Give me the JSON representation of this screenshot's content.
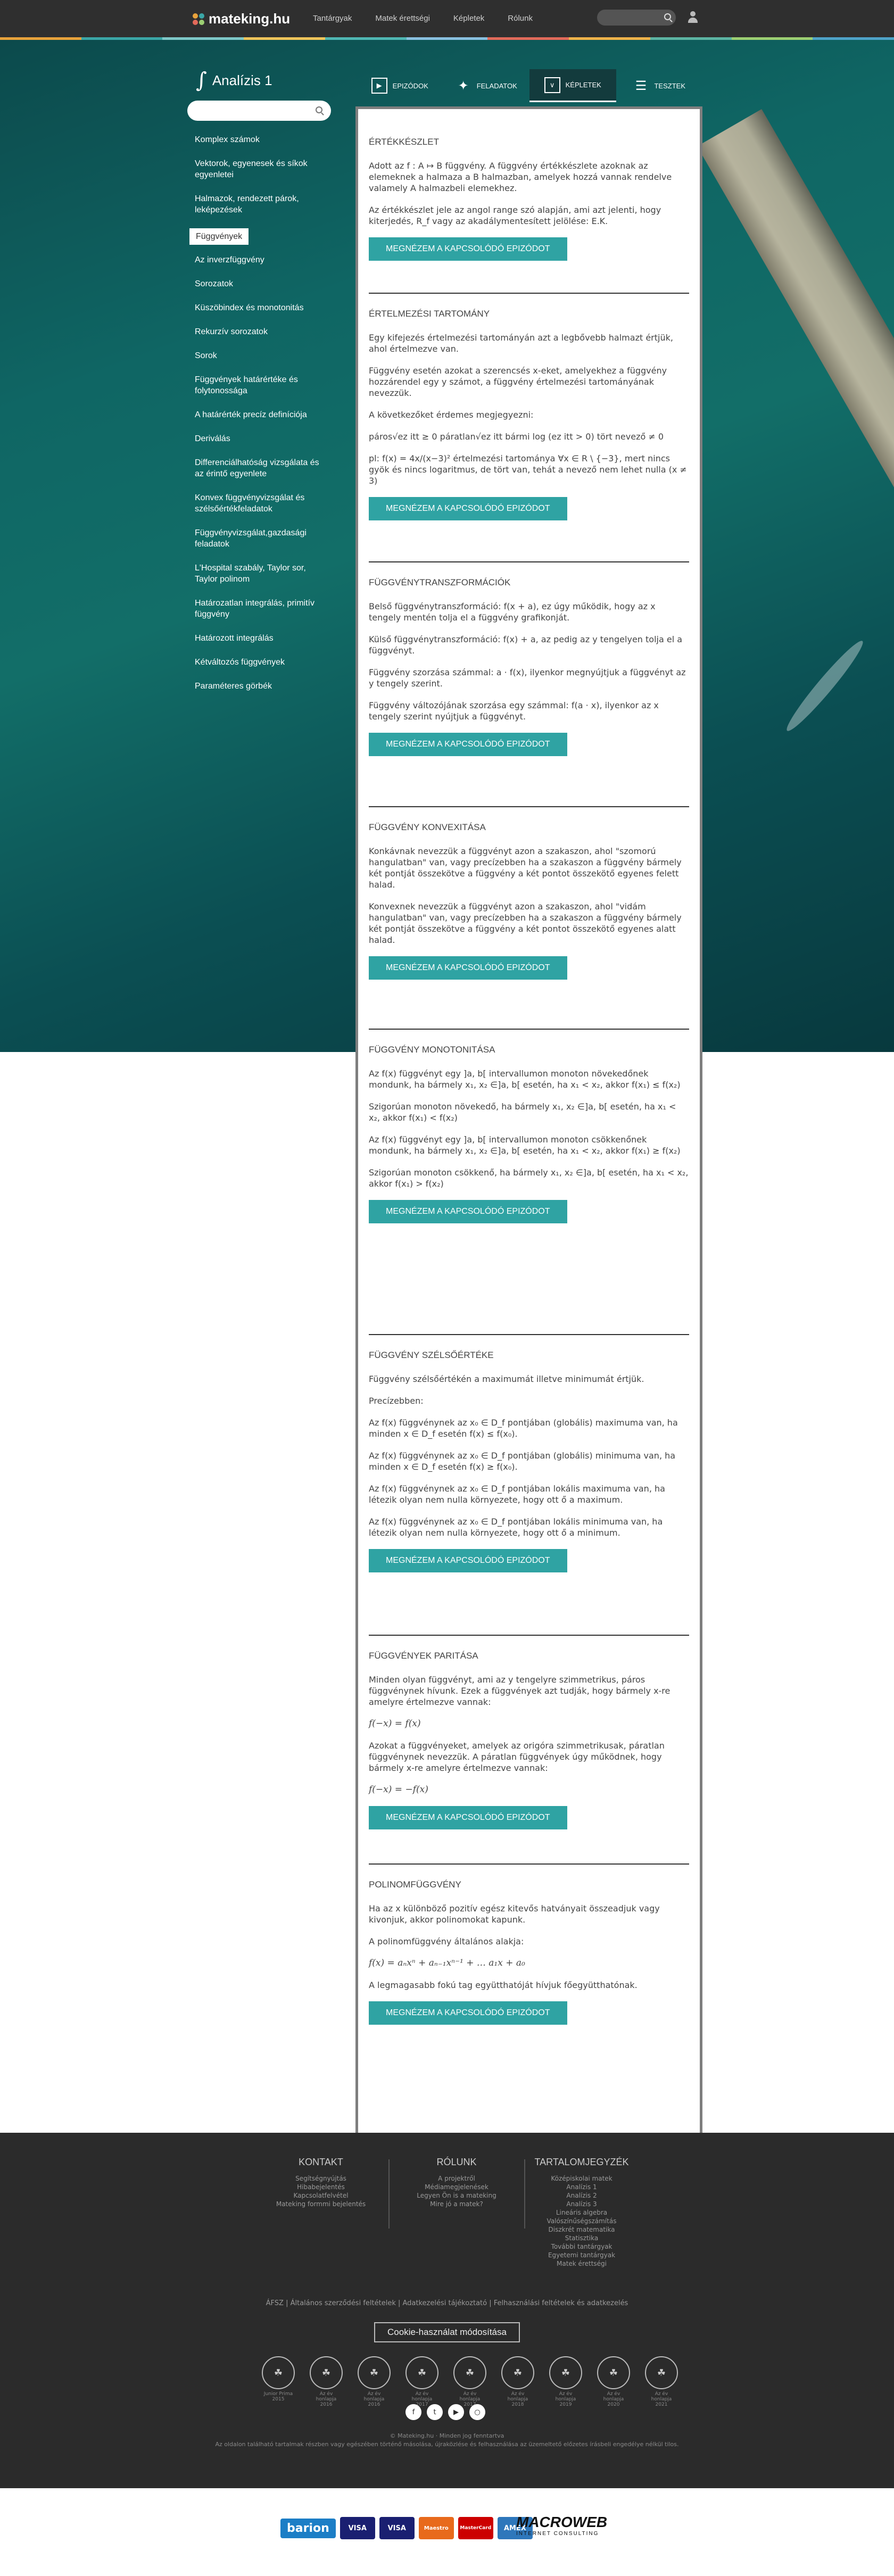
{
  "header": {
    "logo_text": "mateking.hu",
    "nav": [
      "Tantárgyak",
      "Matek érettségi",
      "Képletek",
      "Rólunk"
    ],
    "accent_colors": [
      "#e8a23b",
      "#3aa6a6",
      "#7ec8c8",
      "#f0c45a",
      "#4fb7b3",
      "#89c0e0",
      "#e26a5a",
      "#f0b34a",
      "#5cb4a3",
      "#9ccf72",
      "#4ea3c8"
    ]
  },
  "sidebar": {
    "title": "Analízis 1",
    "integral_symbol": "∫",
    "items": [
      "Komplex számok",
      "Vektorok, egyenesek és síkok egyenletei",
      "Halmazok, rendezett párok, leképezések",
      "Függvények",
      "Az inverzfüggvény",
      "Sorozatok",
      "Küszöbindex és monotonitás",
      "Rekurzív sorozatok",
      "Sorok",
      "Függvények határértéke és folytonossága",
      "A határérték precíz definíciója",
      "Deriválás",
      "Differenciálhatóság vizsgálata és az érintő egyenlete",
      "Konvex függvényvizsgálat és szélsőértékfeladatok",
      "Függvényvizsgálat,gazdasági feladatok",
      "L'Hospital szabály, Taylor sor, Taylor polinom",
      "Határozatlan integrálás, primitív függvény",
      "Határozott integrálás",
      "Kétváltozós függvények",
      "Paraméteres görbék"
    ],
    "active_index": 3
  },
  "tabs": [
    {
      "label": "EPIZÓDOK",
      "icon": "play-icon"
    },
    {
      "label": "FELADATOK",
      "icon": "puzzle-icon"
    },
    {
      "label": "KÉPLETEK",
      "icon": "formula-icon"
    },
    {
      "label": "TESZTEK",
      "icon": "list-icon"
    }
  ],
  "active_tab": 2,
  "button_label": "MEGNÉZEM A KAPCSOLÓDÓ EPIZÓDOT",
  "sections": [
    {
      "title": "ÉRTÉKKÉSZLET",
      "paragraphs": [
        "Adott az f : A ↦ B függvény. A függvény értékkészlete azoknak az elemeknek a halmaza a B halmazban, amelyek hozzá vannak rendelve valamely A halmazbeli elemekhez.",
        "Az értékkészlet jele az angol range szó alapján, ami azt jelenti, hogy kiterjedés, R_f vagy az akadálymentesített jelölése: E.K."
      ]
    },
    {
      "title": "ÉRTELMEZÉSI TARTOMÁNY",
      "paragraphs": [
        "Egy kifejezés értelmezési tartományán azt a legbővebb halmazt értjük, ahol értelmezve van.",
        "Függvény esetén azokat a szerencsés x-eket, amelyekhez a függvény hozzárendel egy y számot, a függvény értelmezési tartományának nevezzük.",
        "A következőket érdemes megjegyezni:",
        "páros√ez itt ≥ 0     páratlan√ez itt bármi     log (ez itt > 0)     tört nevező ≠ 0",
        "pl: f(x) = 4x/(x−3)² értelmezési tartománya ∀x ∈ R \\ {−3}, mert nincs gyök és nincs logaritmus, de tört van, tehát a nevező nem lehet nulla (x ≠ 3)"
      ]
    },
    {
      "title": "FÜGGVÉNYTRANSZFORMÁCIÓK",
      "paragraphs": [
        "Belső függvénytranszformáció: f(x + a), ez úgy működik, hogy az x tengely mentén tolja el a függvény grafikonját.",
        "Külső függvénytranszformáció: f(x) + a, az pedig az y tengelyen tolja el a függvényt.",
        "Függvény szorzása számmal: a · f(x), ilyenkor megnyújtjuk a függvényt az y tengely szerint.",
        "Függvény változójának szorzása egy számmal: f(a · x), ilyenkor az x tengely szerint nyújtjuk a függvényt."
      ]
    },
    {
      "title": "FÜGGVÉNY KONVEXITÁSA",
      "paragraphs": [
        "Konkávnak nevezzük a függvényt azon a szakaszon, ahol \"szomorú hangulatban\" van, vagy precízebben ha a szakaszon a függvény bármely két pontját összekötve a függvény a két pontot összekötő egyenes felett halad.",
        "Konvexnek nevezzük a függvényt azon a szakaszon, ahol \"vidám hangulatban\" van, vagy precízebben ha a szakaszon a függvény bármely két pontját összekötve a függvény a két pontot összekötő egyenes alatt halad."
      ]
    },
    {
      "title": "FÜGGVÉNY MONOTONITÁSA",
      "paragraphs": [
        "Az f(x) függvényt egy ]a, b[ intervallumon monoton növekedőnek mondunk, ha bármely x₁, x₂ ∈]a, b[ esetén, ha x₁ < x₂, akkor f(x₁) ≤ f(x₂)",
        "Szigorúan monoton növekedő, ha bármely x₁, x₂ ∈]a, b[ esetén, ha x₁ < x₂, akkor f(x₁) < f(x₂)",
        "Az f(x) függvényt egy ]a, b[ intervallumon monoton csökkenőnek mondunk, ha bármely x₁, x₂ ∈]a, b[ esetén, ha x₁ < x₂, akkor f(x₁) ≥ f(x₂)",
        "Szigorúan monoton csökkenő, ha bármely x₁, x₂ ∈]a, b[ esetén, ha x₁ < x₂, akkor f(x₁) > f(x₂)"
      ]
    },
    {
      "title": "FÜGGVÉNY SZÉLSŐÉRTÉKE",
      "paragraphs": [
        "Függvény szélsőértékén a maximumát illetve minimumát értjük.",
        "Precízebben:",
        "Az f(x) függvénynek az x₀ ∈ D_f pontjában (globális) maximuma van, ha minden x ∈ D_f esetén f(x) ≤ f(x₀).",
        "Az f(x) függvénynek az x₀ ∈ D_f pontjában (globális) minimuma van, ha minden x ∈ D_f esetén f(x) ≥ f(x₀).",
        "Az f(x) függvénynek az x₀ ∈ D_f pontjában lokális maximuma van, ha létezik olyan nem nulla környezete, hogy ott ő a maximum.",
        "Az f(x) függvénynek az x₀ ∈ D_f pontjában lokális minimuma van, ha létezik olyan nem nulla környezete, hogy ott ő a minimum."
      ]
    },
    {
      "title": "FÜGGVÉNYEK PARITÁSA",
      "paragraphs": [
        "Minden olyan függvényt, ami az y tengelyre szimmetrikus, páros függvénynek hívunk. Ezek a függvények azt tudják, hogy bármely x-re amelyre értelmezve vannak:",
        "f(−x) = f(x)",
        "Azokat a függvényeket, amelyek az origóra szimmetrikusak, páratlan függvénynek nevezzük. A páratlan függvények úgy működnek, hogy bármely x-re amelyre értelmezve vannak:",
        "f(−x) = −f(x)"
      ]
    },
    {
      "title": "POLINOMFÜGGVÉNY",
      "paragraphs": [
        "Ha az x különböző pozitív egész kitevős hatványait összeadjuk vagy kivonjuk, akkor polinomokat kapunk.",
        "A polinomfüggvény általános alakja:",
        "f(x) = aₙxⁿ + aₙ₋₁xⁿ⁻¹ + … a₁x + a₀",
        "A legmagasabb fokú tag együtthatóját hívjuk főegyütthatónak."
      ]
    }
  ],
  "footer": {
    "columns": [
      {
        "title": "KONTAKT",
        "links": [
          "Segítségnyújtás",
          "Hibabejelentés",
          "Kapcsolatfelvétel",
          "Mateking formmi bejelentés"
        ]
      },
      {
        "title": "RÓLUNK",
        "links": [
          "A projektről",
          "Médiamegjelenések",
          "Legyen Ön is a mateking",
          "Mire jó a matek?"
        ]
      },
      {
        "title": "TARTALOMJEGYZÉK",
        "links": [
          "Középiskolai matek",
          "Analízis 1",
          "Analízis 2",
          "Analízis 3",
          "Lineáris algebra",
          "Valószínűségszámítás",
          "Diszkrét matematika",
          "Statisztika",
          "További tantárgyak",
          "Egyetemi tantárgyak",
          "Matek érettségi"
        ]
      }
    ],
    "legal_links": "ÁFSZ  |  Általános szerződési feltételek  |  Adatkezelési tájékoztató  |  Felhasználási feltételek és adatkezelés",
    "cookie_button": "Cookie-használat módosítása",
    "badges": [
      "Junior Prima 2015",
      "Az év honlapja 2016",
      "Az év honlapja 2016",
      "Az év honlapja 2017",
      "Az év honlapja 2017",
      "Az év honlapja 2018",
      "Az év honlapja 2019",
      "Az év honlapja 2020",
      "Az év honlapja 2021"
    ],
    "social_icons": [
      "facebook-icon",
      "twitter-icon",
      "youtube-icon",
      "instagram-icon"
    ],
    "copyright": "© Mateking.hu · Minden jog fenntartva",
    "disclaimer": "Az oldalon található tartalmak részben vagy egészében történő másolása, újraközlése és felhasználása az üzemeltető előzetes írásbeli engedélye nélkül tilos."
  },
  "payment": {
    "provider": "barion",
    "cards": [
      "VISA",
      "VISA",
      "Maestro",
      "MasterCard",
      "AMEX"
    ],
    "agency": "MACROWEB",
    "agency_sub": "INTERNET CONSULTING"
  }
}
